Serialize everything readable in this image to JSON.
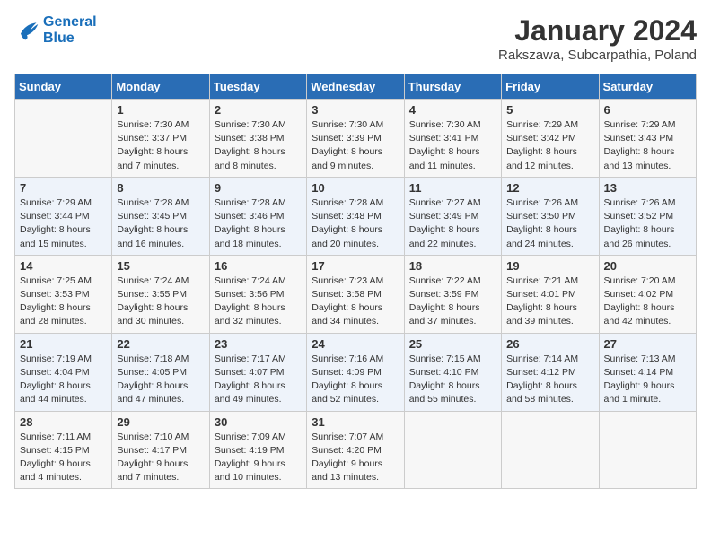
{
  "logo": {
    "line1": "General",
    "line2": "Blue"
  },
  "title": "January 2024",
  "subtitle": "Rakszawa, Subcarpathia, Poland",
  "days_header": [
    "Sunday",
    "Monday",
    "Tuesday",
    "Wednesday",
    "Thursday",
    "Friday",
    "Saturday"
  ],
  "weeks": [
    [
      {
        "day": "",
        "info": ""
      },
      {
        "day": "1",
        "info": "Sunrise: 7:30 AM\nSunset: 3:37 PM\nDaylight: 8 hours\nand 7 minutes."
      },
      {
        "day": "2",
        "info": "Sunrise: 7:30 AM\nSunset: 3:38 PM\nDaylight: 8 hours\nand 8 minutes."
      },
      {
        "day": "3",
        "info": "Sunrise: 7:30 AM\nSunset: 3:39 PM\nDaylight: 8 hours\nand 9 minutes."
      },
      {
        "day": "4",
        "info": "Sunrise: 7:30 AM\nSunset: 3:41 PM\nDaylight: 8 hours\nand 11 minutes."
      },
      {
        "day": "5",
        "info": "Sunrise: 7:29 AM\nSunset: 3:42 PM\nDaylight: 8 hours\nand 12 minutes."
      },
      {
        "day": "6",
        "info": "Sunrise: 7:29 AM\nSunset: 3:43 PM\nDaylight: 8 hours\nand 13 minutes."
      }
    ],
    [
      {
        "day": "7",
        "info": "Sunrise: 7:29 AM\nSunset: 3:44 PM\nDaylight: 8 hours\nand 15 minutes."
      },
      {
        "day": "8",
        "info": "Sunrise: 7:28 AM\nSunset: 3:45 PM\nDaylight: 8 hours\nand 16 minutes."
      },
      {
        "day": "9",
        "info": "Sunrise: 7:28 AM\nSunset: 3:46 PM\nDaylight: 8 hours\nand 18 minutes."
      },
      {
        "day": "10",
        "info": "Sunrise: 7:28 AM\nSunset: 3:48 PM\nDaylight: 8 hours\nand 20 minutes."
      },
      {
        "day": "11",
        "info": "Sunrise: 7:27 AM\nSunset: 3:49 PM\nDaylight: 8 hours\nand 22 minutes."
      },
      {
        "day": "12",
        "info": "Sunrise: 7:26 AM\nSunset: 3:50 PM\nDaylight: 8 hours\nand 24 minutes."
      },
      {
        "day": "13",
        "info": "Sunrise: 7:26 AM\nSunset: 3:52 PM\nDaylight: 8 hours\nand 26 minutes."
      }
    ],
    [
      {
        "day": "14",
        "info": "Sunrise: 7:25 AM\nSunset: 3:53 PM\nDaylight: 8 hours\nand 28 minutes."
      },
      {
        "day": "15",
        "info": "Sunrise: 7:24 AM\nSunset: 3:55 PM\nDaylight: 8 hours\nand 30 minutes."
      },
      {
        "day": "16",
        "info": "Sunrise: 7:24 AM\nSunset: 3:56 PM\nDaylight: 8 hours\nand 32 minutes."
      },
      {
        "day": "17",
        "info": "Sunrise: 7:23 AM\nSunset: 3:58 PM\nDaylight: 8 hours\nand 34 minutes."
      },
      {
        "day": "18",
        "info": "Sunrise: 7:22 AM\nSunset: 3:59 PM\nDaylight: 8 hours\nand 37 minutes."
      },
      {
        "day": "19",
        "info": "Sunrise: 7:21 AM\nSunset: 4:01 PM\nDaylight: 8 hours\nand 39 minutes."
      },
      {
        "day": "20",
        "info": "Sunrise: 7:20 AM\nSunset: 4:02 PM\nDaylight: 8 hours\nand 42 minutes."
      }
    ],
    [
      {
        "day": "21",
        "info": "Sunrise: 7:19 AM\nSunset: 4:04 PM\nDaylight: 8 hours\nand 44 minutes."
      },
      {
        "day": "22",
        "info": "Sunrise: 7:18 AM\nSunset: 4:05 PM\nDaylight: 8 hours\nand 47 minutes."
      },
      {
        "day": "23",
        "info": "Sunrise: 7:17 AM\nSunset: 4:07 PM\nDaylight: 8 hours\nand 49 minutes."
      },
      {
        "day": "24",
        "info": "Sunrise: 7:16 AM\nSunset: 4:09 PM\nDaylight: 8 hours\nand 52 minutes."
      },
      {
        "day": "25",
        "info": "Sunrise: 7:15 AM\nSunset: 4:10 PM\nDaylight: 8 hours\nand 55 minutes."
      },
      {
        "day": "26",
        "info": "Sunrise: 7:14 AM\nSunset: 4:12 PM\nDaylight: 8 hours\nand 58 minutes."
      },
      {
        "day": "27",
        "info": "Sunrise: 7:13 AM\nSunset: 4:14 PM\nDaylight: 9 hours\nand 1 minute."
      }
    ],
    [
      {
        "day": "28",
        "info": "Sunrise: 7:11 AM\nSunset: 4:15 PM\nDaylight: 9 hours\nand 4 minutes."
      },
      {
        "day": "29",
        "info": "Sunrise: 7:10 AM\nSunset: 4:17 PM\nDaylight: 9 hours\nand 7 minutes."
      },
      {
        "day": "30",
        "info": "Sunrise: 7:09 AM\nSunset: 4:19 PM\nDaylight: 9 hours\nand 10 minutes."
      },
      {
        "day": "31",
        "info": "Sunrise: 7:07 AM\nSunset: 4:20 PM\nDaylight: 9 hours\nand 13 minutes."
      },
      {
        "day": "",
        "info": ""
      },
      {
        "day": "",
        "info": ""
      },
      {
        "day": "",
        "info": ""
      }
    ]
  ]
}
